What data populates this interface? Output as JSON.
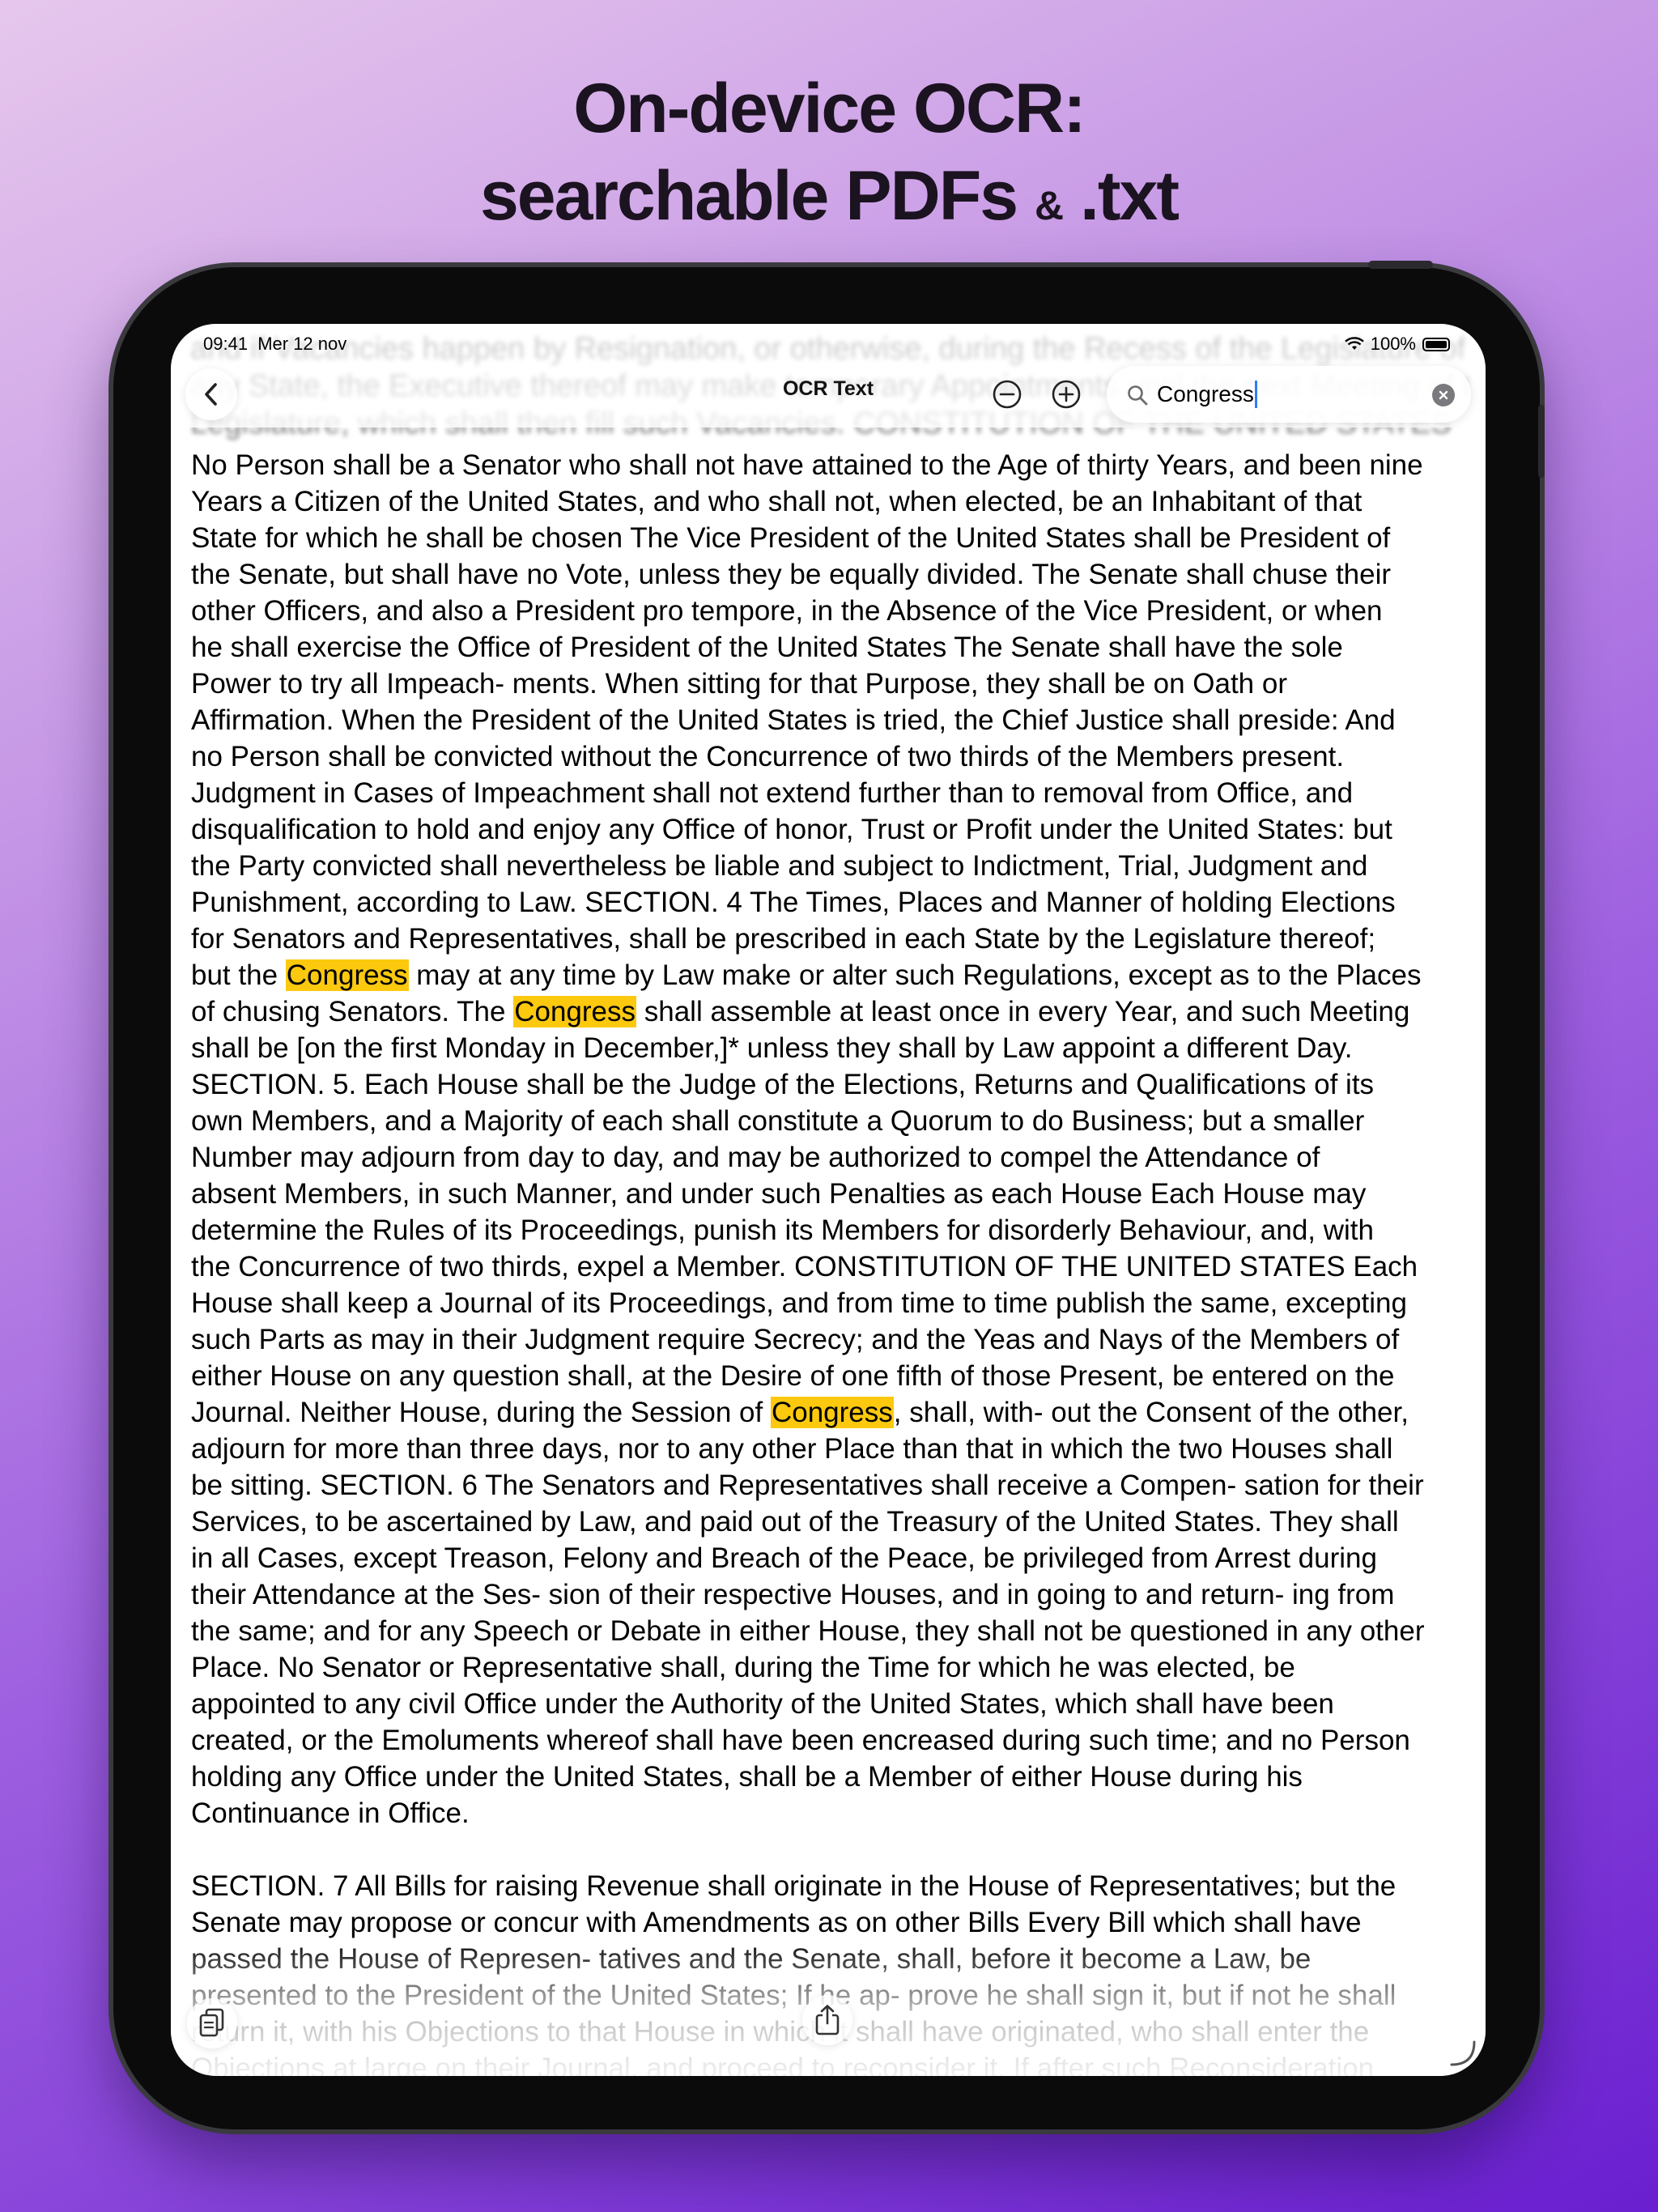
{
  "headline": {
    "line1": "On-device OCR:",
    "line2_main": "searchable PDFs",
    "line2_amp": "&",
    "line2_end": ".txt"
  },
  "status_bar": {
    "time": "09:41",
    "date": "Mer 12 nov",
    "battery": "100%"
  },
  "nav": {
    "title": "OCR Text",
    "back_icon": "chevron-left-icon",
    "zoom_out_icon": "minus-circle-icon",
    "zoom_in_icon": "plus-circle-icon"
  },
  "search": {
    "value": "Congress",
    "icon": "search-icon",
    "clear_icon": "clear-icon"
  },
  "highlight_color": "#fcc90f",
  "ghost_text": [
    "and if Vacancies happen by Resignation, or otherwise, during the Recess of the Legislature of",
    "any State, the Executive thereof may make temporary Appointments until the next Meeting of the",
    "Legislature, which shall then fill such Vacancies. CONSTITUTION OF THE UNITED STATES"
  ],
  "ocr_lines": [
    "No Person shall be a Senator who shall not have attained to the Age of thirty Years, and been nine",
    "Years a Citizen of the United States, and who shall not, when elected, be an Inhabitant of that",
    "State for which he shall be chosen The Vice President of the United States shall be President of",
    "the Senate, but shall have no Vote, unless they be equally divided. The Senate shall chuse their",
    "other Officers, and also a President pro tempore, in the Absence of the Vice President, or when",
    "he shall exercise the Office of President of the United States The Senate shall have the sole",
    "Power to try all Impeach- ments. When sitting for that Purpose, they shall be on Oath or",
    "Affirmation. When the President of the United States is tried, the Chief Justice shall preside: And",
    "no Person shall be convicted without the Concurrence of two thirds of the Members present.",
    "Judgment in Cases of Impeachment shall not extend further than to removal from Office, and",
    "disqualification to hold and enjoy any Office of honor, Trust or Profit under the United States: but",
    "the Party convicted shall nevertheless be liable and subject to Indictment, Trial, Judgment and",
    "Punishment, according to Law. SECTION. 4 The Times, Places and Manner of holding Elections",
    "for Senators and Representatives, shall be prescribed in each State by the Legislature thereof;",
    "but the Congress may at any time by Law make or alter such Regulations, except as to the Places",
    "of chusing Senators. The Congress shall assemble at least once in every Year, and such Meeting",
    "shall be [on the first Monday in December,]* unless they shall by Law appoint a different Day.",
    "SECTION. 5. Each House shall be the Judge of the Elections, Returns and Qualifications of its",
    "own Members, and a Majority of each shall constitute a Quorum to do Business; but a smaller",
    "Number may adjourn from day to day, and may be authorized to compel the Attendance of",
    "absent Members, in such Manner, and under such Penalties as each House Each House may",
    "determine the Rules of its Proceedings, punish its Members for disorderly Behaviour, and, with",
    "the Concurrence of two thirds, expel a Member. CONSTITUTION OF THE UNITED STATES Each",
    "House shall keep a Journal of its Proceedings, and from time to time publish the same, excepting",
    "such Parts as may in their Judgment require Secrecy; and the Yeas and Nays of the Members of",
    "either House on any question shall, at the Desire of one fifth of those Present, be entered on the",
    "Journal. Neither House, during the Session of Congress, shall, with- out the Consent of the other,",
    "adjourn for more than three days, nor to any other Place than that in which the two Houses shall",
    "be sitting. SECTION. 6 The Senators and Representatives shall receive a Compen- sation for their",
    "Services, to be ascertained by Law, and paid out of the Treasury of the United States. They shall",
    "in all Cases, except Treason, Felony and Breach of the Peace, be privileged from Arrest during",
    "their Attendance at the Ses- sion of their respective Houses, and in going to and return- ing from",
    "the same; and for any Speech or Debate in either House, they shall not be questioned in any other",
    "Place. No Senator or Representative shall, during the Time for which he was elected, be",
    "appointed to any civil Office under the Authority of the United States, which shall have been",
    "created, or the Emoluments whereof shall have been encreased during such time; and no Person",
    "holding any Office under the United States, shall be a Member of either House during his",
    "Continuance in Office.",
    "",
    "SECTION. 7 All Bills for raising Revenue shall originate in the House of Representatives; but the",
    "Senate may propose or concur with Amendments as on other Bills Every Bill which shall have",
    "passed the House of Represen- tatives and the Senate, shall, before it become a Law, be",
    "presented to the President of the United States; If he ap- prove he shall sign it, but if not he shall",
    "return it, with his Objections to that House in which it shall have originated, who shall enter the",
    "Objections at large on their Journal, and proceed to reconsider it. If after such Reconsideration"
  ],
  "toolbar": {
    "copy_icon": "copy-icon",
    "share_icon": "share-icon"
  }
}
